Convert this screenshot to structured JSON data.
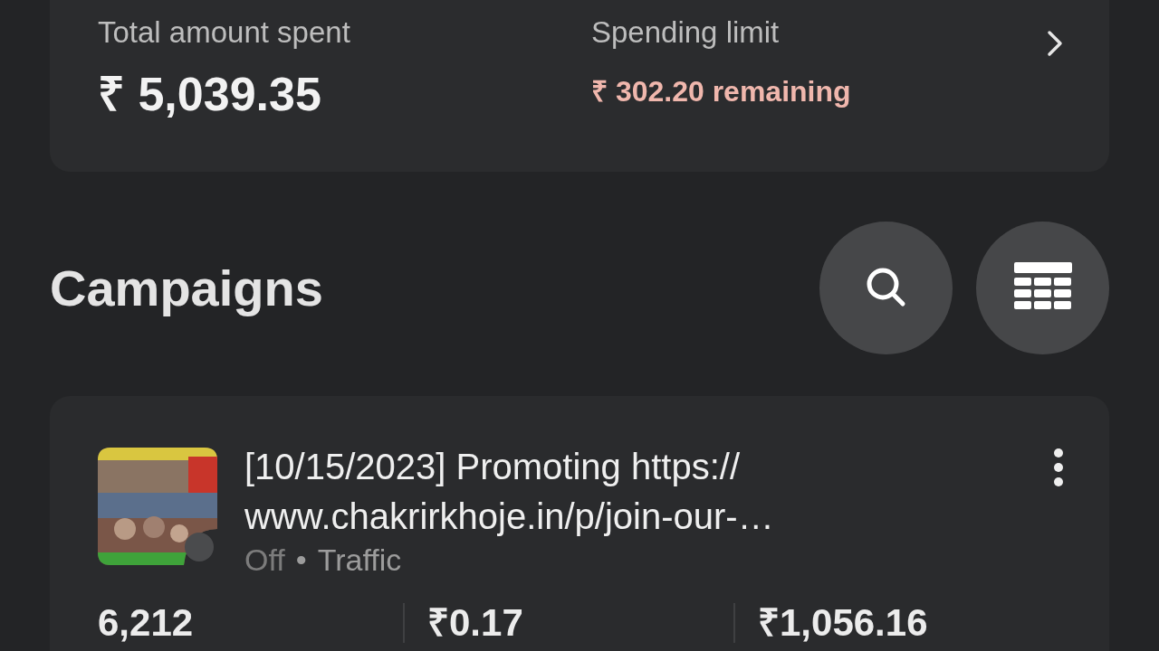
{
  "summary": {
    "total_label": "Total amount spent",
    "total_value": "₹ 5,039.35",
    "limit_label": "Spending limit",
    "limit_value": "₹ 302.20 remaining"
  },
  "campaigns": {
    "title": "Campaigns",
    "items": [
      {
        "kind": "picture",
        "title_line_1": "[10/15/2023] Promoting https://",
        "title_line_2": "www.chakrirkhoje.in/p/join-our-…",
        "on": false,
        "status": "Off",
        "objective": "Traffic",
        "separator": "•",
        "metrics": [
          "6,212",
          "₹0.17",
          "₹1,056.16"
        ]
      }
    ]
  }
}
